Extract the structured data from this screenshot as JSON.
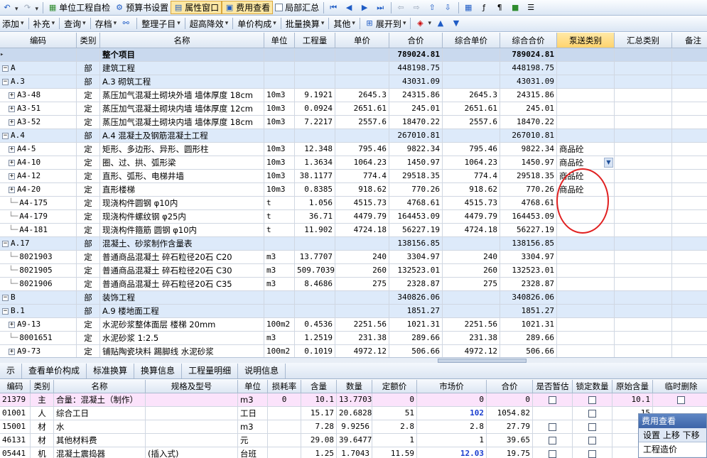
{
  "toolbar1": {
    "items": [
      "单位工程自检",
      "预算书设置",
      "属性窗口",
      "费用查看",
      "局部汇总"
    ]
  },
  "toolbar2": {
    "items": [
      "添加",
      "补充",
      "查询",
      "存档",
      "整理子目",
      "超高降效",
      "单价构成",
      "批量换算",
      "其他",
      "展开到"
    ]
  },
  "grid": {
    "headers": [
      "编码",
      "类别",
      "名称",
      "单位",
      "工程量",
      "单价",
      "合价",
      "综合单价",
      "综合合价",
      "泵送类别",
      "汇总类别",
      "备注"
    ],
    "rows": [
      {
        "code": "",
        "cat": "",
        "name": "整个项目",
        "unit": "",
        "qty": "",
        "price": "",
        "total": "789024.81",
        "cprice": "",
        "ctotal": "789024.81",
        "pump": ""
      },
      {
        "code": "A",
        "cat": "部",
        "name": "建筑工程",
        "unit": "",
        "qty": "",
        "price": "",
        "total": "448198.75",
        "cprice": "",
        "ctotal": "448198.75",
        "pump": ""
      },
      {
        "code": "A.3",
        "cat": "部",
        "name": "A.3 砌筑工程",
        "unit": "",
        "qty": "",
        "price": "",
        "total": "43031.09",
        "cprice": "",
        "ctotal": "43031.09",
        "pump": ""
      },
      {
        "code": "A3-48",
        "cat": "定",
        "name": "蒸压加气混凝土砌块外墙 墙体厚度 18cm",
        "unit": "10m3",
        "qty": "9.1921",
        "price": "2645.3",
        "total": "24315.86",
        "cprice": "2645.3",
        "ctotal": "24315.86",
        "pump": ""
      },
      {
        "code": "A3-51",
        "cat": "定",
        "name": "蒸压加气混凝土砌块内墙 墙体厚度 12cm",
        "unit": "10m3",
        "qty": "0.0924",
        "price": "2651.61",
        "total": "245.01",
        "cprice": "2651.61",
        "ctotal": "245.01",
        "pump": ""
      },
      {
        "code": "A3-52",
        "cat": "定",
        "name": "蒸压加气混凝土砌块内墙 墙体厚度 18cm",
        "unit": "10m3",
        "qty": "7.2217",
        "price": "2557.6",
        "total": "18470.22",
        "cprice": "2557.6",
        "ctotal": "18470.22",
        "pump": ""
      },
      {
        "code": "A.4",
        "cat": "部",
        "name": "A.4 混凝土及钢筋混凝土工程",
        "unit": "",
        "qty": "",
        "price": "",
        "total": "267010.81",
        "cprice": "",
        "ctotal": "267010.81",
        "pump": ""
      },
      {
        "code": "A4-5",
        "cat": "定",
        "name": "矩形、多边形、异形、圆形柱",
        "unit": "10m3",
        "qty": "12.348",
        "price": "795.46",
        "total": "9822.34",
        "cprice": "795.46",
        "ctotal": "9822.34",
        "pump": "商品砼"
      },
      {
        "code": "A4-10",
        "cat": "定",
        "name": "圈、过、拱、弧形梁",
        "unit": "10m3",
        "qty": "1.3634",
        "price": "1064.23",
        "total": "1450.97",
        "cprice": "1064.23",
        "ctotal": "1450.97",
        "pump": "商品砼"
      },
      {
        "code": "A4-12",
        "cat": "定",
        "name": "直形、弧形、电梯井墙",
        "unit": "10m3",
        "qty": "38.1177",
        "price": "774.4",
        "total": "29518.35",
        "cprice": "774.4",
        "ctotal": "29518.35",
        "pump": "商品砼"
      },
      {
        "code": "A4-20",
        "cat": "定",
        "name": "直形楼梯",
        "unit": "10m3",
        "qty": "0.8385",
        "price": "918.62",
        "total": "770.26",
        "cprice": "918.62",
        "ctotal": "770.26",
        "pump": "商品砼"
      },
      {
        "code": "A4-175",
        "cat": "定",
        "name": "现浇构件圆钢 φ10内",
        "unit": "t",
        "qty": "1.056",
        "price": "4515.73",
        "total": "4768.61",
        "cprice": "4515.73",
        "ctotal": "4768.61",
        "pump": ""
      },
      {
        "code": "A4-179",
        "cat": "定",
        "name": "现浇构件螺纹钢 φ25内",
        "unit": "t",
        "qty": "36.71",
        "price": "4479.79",
        "total": "164453.09",
        "cprice": "4479.79",
        "ctotal": "164453.09",
        "pump": ""
      },
      {
        "code": "A4-181",
        "cat": "定",
        "name": "现浇构件箍筋 圆钢 φ10内",
        "unit": "t",
        "qty": "11.902",
        "price": "4724.18",
        "total": "56227.19",
        "cprice": "4724.18",
        "ctotal": "56227.19",
        "pump": ""
      },
      {
        "code": "A.17",
        "cat": "部",
        "name": "混凝土、砂浆制作含量表",
        "unit": "",
        "qty": "",
        "price": "",
        "total": "138156.85",
        "cprice": "",
        "ctotal": "138156.85",
        "pump": ""
      },
      {
        "code": "8021903",
        "cat": "定",
        "name": "普通商品混凝土 碎石粒径20石 C20",
        "unit": "m3",
        "qty": "13.7707",
        "price": "240",
        "total": "3304.97",
        "cprice": "240",
        "ctotal": "3304.97",
        "pump": ""
      },
      {
        "code": "8021905",
        "cat": "定",
        "name": "普通商品混凝土 碎石粒径20石 C30",
        "unit": "m3",
        "qty": "509.7039",
        "price": "260",
        "total": "132523.01",
        "cprice": "260",
        "ctotal": "132523.01",
        "pump": ""
      },
      {
        "code": "8021906",
        "cat": "定",
        "name": "普通商品混凝土 碎石粒径20石 C35",
        "unit": "m3",
        "qty": "8.4686",
        "price": "275",
        "total": "2328.87",
        "cprice": "275",
        "ctotal": "2328.87",
        "pump": ""
      },
      {
        "code": "B",
        "cat": "部",
        "name": "装饰工程",
        "unit": "",
        "qty": "",
        "price": "",
        "total": "340826.06",
        "cprice": "",
        "ctotal": "340826.06",
        "pump": ""
      },
      {
        "code": "B.1",
        "cat": "部",
        "name": "A.9 楼地面工程",
        "unit": "",
        "qty": "",
        "price": "",
        "total": "1851.27",
        "cprice": "",
        "ctotal": "1851.27",
        "pump": ""
      },
      {
        "code": "A9-13",
        "cat": "定",
        "name": "水泥砂浆整体面层 楼梯 20mm",
        "unit": "100m2",
        "qty": "0.4536",
        "price": "2251.56",
        "total": "1021.31",
        "cprice": "2251.56",
        "ctotal": "1021.31",
        "pump": ""
      },
      {
        "code": "8001651",
        "cat": "定",
        "name": "水泥砂浆 1:2.5",
        "unit": "m3",
        "qty": "1.2519",
        "price": "231.38",
        "total": "289.66",
        "cprice": "231.38",
        "ctotal": "289.66",
        "pump": ""
      },
      {
        "code": "A9-73",
        "cat": "定",
        "name": "铺贴陶瓷块料 踢脚线 水泥砂浆",
        "unit": "100m2",
        "qty": "0.1019",
        "price": "4972.12",
        "total": "506.66",
        "cprice": "4972.12",
        "ctotal": "506.66",
        "pump": ""
      }
    ]
  },
  "tabs": [
    "示",
    "查看单价构成",
    "标准换算",
    "换算信息",
    "工程量明细",
    "说明信息"
  ],
  "bottom_grid": {
    "headers": [
      "编码",
      "类别",
      "名称",
      "规格及型号",
      "单位",
      "损耗率",
      "含量",
      "数量",
      "定额价",
      "市场价",
      "合价",
      "是否暂估",
      "锁定数量",
      "原始含量",
      "临时删除"
    ],
    "rows": [
      {
        "code": "21379",
        "cat": "主",
        "name": "合量：混凝土（制作）",
        "spec": "",
        "unit": "m3",
        "loss": "0",
        "amount": "10.1",
        "qty": "13.7703",
        "quota": "0",
        "market": "0",
        "total": "0",
        "orig": "10.1"
      },
      {
        "code": "01001",
        "cat": "人",
        "name": "综合工日",
        "spec": "",
        "unit": "工日",
        "loss": "",
        "amount": "15.17",
        "qty": "20.6828",
        "quota": "51",
        "market": "102",
        "total": "1054.82",
        "orig": "15"
      },
      {
        "code": "15001",
        "cat": "材",
        "name": "水",
        "spec": "",
        "unit": "m3",
        "loss": "",
        "amount": "7.28",
        "qty": "9.9256",
        "quota": "2.8",
        "market": "2.8",
        "total": "27.79",
        "orig": "7"
      },
      {
        "code": "46131",
        "cat": "材",
        "name": "其他材料费",
        "spec": "",
        "unit": "元",
        "loss": "",
        "amount": "29.08",
        "qty": "39.6477",
        "quota": "1",
        "market": "1",
        "total": "39.65",
        "orig": "29"
      },
      {
        "code": "05441",
        "cat": "机",
        "name": "混凝土震捣器",
        "spec": "(插入式)",
        "unit": "台班",
        "loss": "",
        "amount": "1.25",
        "qty": "1.7043",
        "quota": "11.59",
        "market": "12.03",
        "total": "19.75",
        "orig": ""
      }
    ]
  },
  "panel": {
    "title": "费用查看",
    "toolbar": "设置  上移  下移",
    "item": "工程造价"
  }
}
